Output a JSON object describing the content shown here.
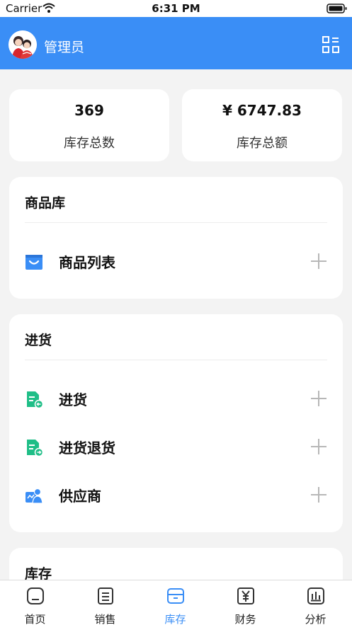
{
  "status_bar": {
    "carrier": "Carrier",
    "time": "6:31 PM"
  },
  "header": {
    "title": "管理员"
  },
  "stats": [
    {
      "value": "369",
      "label": "库存总数"
    },
    {
      "value": "¥ 6747.83",
      "label": "库存总额"
    }
  ],
  "sections": {
    "goods": {
      "title": "商品库",
      "items": [
        {
          "label": "商品列表"
        }
      ]
    },
    "purchase": {
      "title": "进货",
      "items": [
        {
          "label": "进货"
        },
        {
          "label": "进货退货"
        },
        {
          "label": "供应商"
        }
      ]
    },
    "inventory": {
      "title": "库存"
    }
  },
  "tabbar": {
    "tabs": [
      {
        "label": "首页",
        "icon": "home-icon"
      },
      {
        "label": "销售",
        "icon": "sales-list-icon"
      },
      {
        "label": "库存",
        "icon": "inventory-box-icon",
        "active": true
      },
      {
        "label": "财务",
        "icon": "yen-finance-icon"
      },
      {
        "label": "分析",
        "icon": "bar-chart-icon"
      }
    ]
  },
  "colors": {
    "primary": "#3a8ef6",
    "green": "#1fbe87",
    "background": "#f3f3f3"
  }
}
